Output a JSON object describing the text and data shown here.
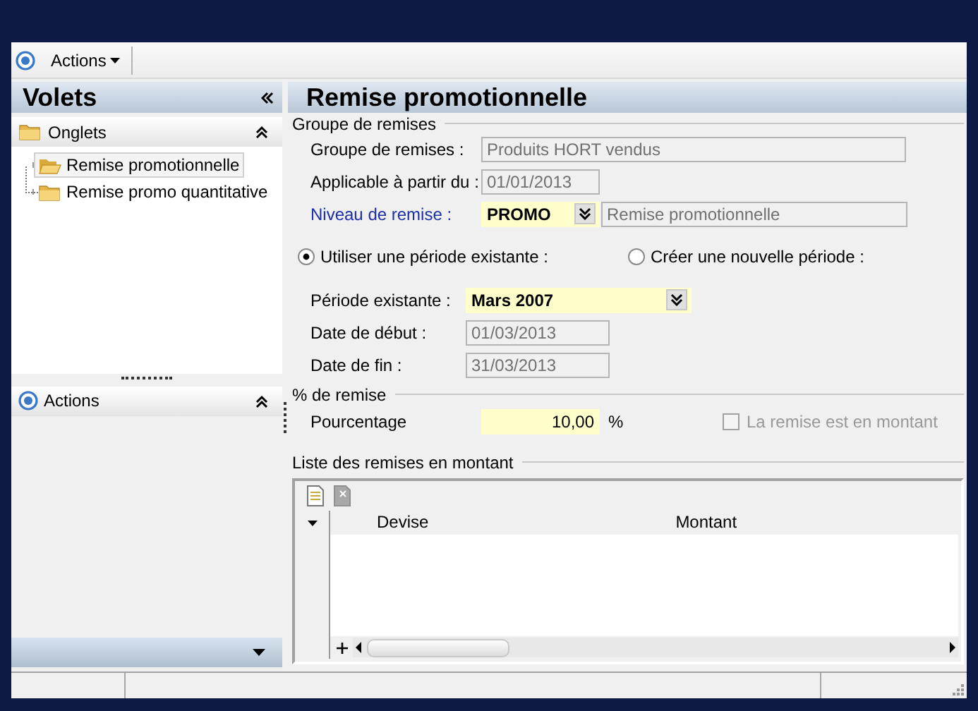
{
  "toolbar": {
    "actions_label": "Actions"
  },
  "sidebar": {
    "title": "Volets",
    "sections": [
      {
        "title": "Onglets",
        "expanded": true,
        "kind": "tree",
        "items": [
          {
            "label": "Remise promotionnelle",
            "selected": true
          },
          {
            "label": "Remise promo quantitative",
            "selected": false
          }
        ]
      },
      {
        "title": "Actions",
        "expanded": true,
        "kind": "actions"
      }
    ]
  },
  "form": {
    "title": "Remise promotionnelle",
    "group": {
      "legend": "Groupe de remises",
      "fields": [
        {
          "label": "Groupe de remises :",
          "kind": "readonly",
          "value": "Produits HORT vendus",
          "wide": true,
          "link": false
        },
        {
          "label": "Applicable à partir du :",
          "kind": "readonly",
          "value": "01/01/2013",
          "wide": false,
          "link": false
        },
        {
          "label": "Niveau de remise :",
          "kind": "combo",
          "value": "PROMO",
          "description": "Remise promotionnelle",
          "link": true
        }
      ]
    },
    "period_options": [
      {
        "label": "Utiliser une période existante :",
        "selected": true
      },
      {
        "label": "Créer une nouvelle période :",
        "selected": false
      }
    ],
    "period_fields": [
      {
        "label": "Période existante :",
        "kind": "combo",
        "value": "Mars 2007"
      },
      {
        "label": "Date de début :",
        "kind": "readonly",
        "value": "01/03/2013"
      },
      {
        "label": "Date de fin :",
        "kind": "readonly",
        "value": "31/03/2013"
      }
    ],
    "percent": {
      "legend": "% de remise",
      "label": "Pourcentage",
      "value": "10,00",
      "unit": "%",
      "checkbox": {
        "label": "La remise est en montant",
        "checked": false,
        "disabled": true
      }
    },
    "amounts": {
      "legend": "Liste des remises en montant",
      "columns": [
        "Devise",
        "Montant"
      ]
    }
  }
}
